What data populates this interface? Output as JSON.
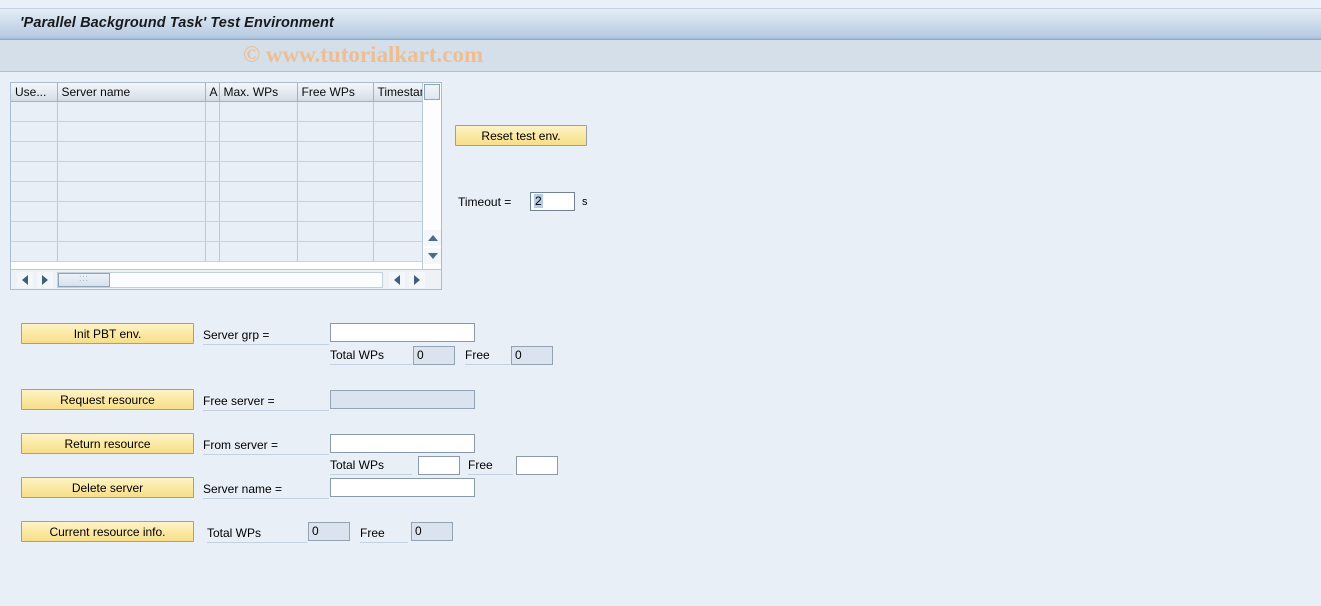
{
  "header": {
    "title": "'Parallel Background Task' Test Environment",
    "watermark": "© www.tutorialkart.com"
  },
  "table": {
    "columns": [
      "Use...",
      "Server name",
      "A",
      "Max. WPs",
      "Free WPs",
      "Timestamp"
    ],
    "rows": [
      [
        "",
        "",
        "",
        "",
        "",
        ""
      ],
      [
        "",
        "",
        "",
        "",
        "",
        ""
      ],
      [
        "",
        "",
        "",
        "",
        "",
        ""
      ],
      [
        "",
        "",
        "",
        "",
        "",
        ""
      ],
      [
        "",
        "",
        "",
        "",
        "",
        ""
      ],
      [
        "",
        "",
        "",
        "",
        "",
        ""
      ],
      [
        "",
        "",
        "",
        "",
        "",
        ""
      ],
      [
        "",
        "",
        "",
        "",
        "",
        ""
      ]
    ]
  },
  "panel": {
    "reset_label": "Reset test env.",
    "timeout_label": "Timeout  =",
    "timeout_value": "2",
    "timeout_unit": "s"
  },
  "form": {
    "init_label": "Init PBT env.",
    "request_label": "Request resource",
    "return_label": "Return resource",
    "delete_label": "Delete server",
    "info_label": "Current resource info.",
    "server_grp_label": "Server grp =",
    "server_grp_value": "",
    "total_wps_label_1": "Total WPs",
    "total_wps_value_1": "0",
    "free_label_1": "Free",
    "free_value_1": "0",
    "free_server_label": "Free server =",
    "free_server_value": "",
    "from_server_label": "From server   =",
    "from_server_value": "",
    "total_wps_label_2": "Total WPs",
    "total_wps_value_2": "",
    "free_label_2": "Free",
    "free_value_2": "",
    "server_name_label": "Server name =",
    "server_name_value": "",
    "total_wps_label_3": "Total WPs",
    "total_wps_value_3": "0",
    "free_label_3": "Free",
    "free_value_3": "0"
  },
  "colors": {
    "background": "#e9eff7",
    "titlebar_end": "#9fbcd8",
    "button_yellow": "#fbe9a3",
    "watermark": "#edbe93",
    "field_readonly": "#dbe4ee"
  }
}
